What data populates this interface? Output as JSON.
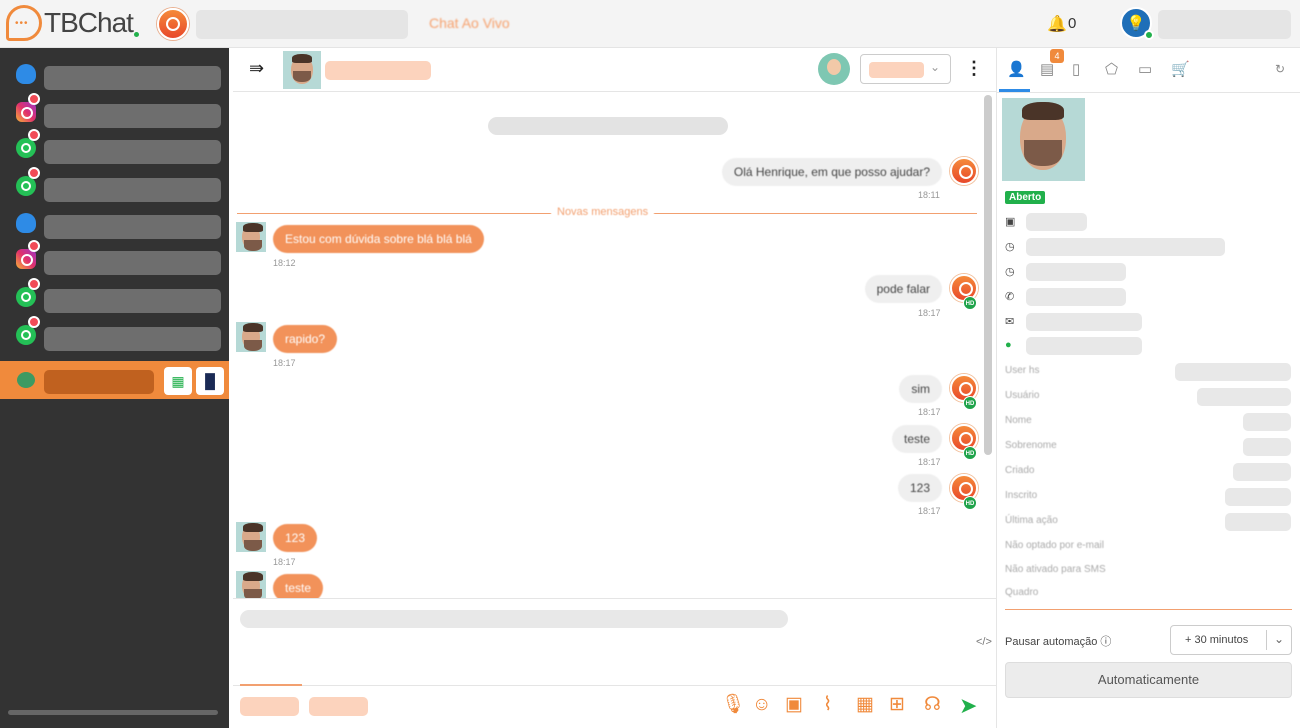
{
  "topbar": {
    "logo_text": "TBChat",
    "live_label": "Chat Ao Vivo",
    "notif_count": "0"
  },
  "sidebar": {
    "items": [
      {
        "channel": "user-icon",
        "badge": false
      },
      {
        "channel": "instagram-icon",
        "badge": true
      },
      {
        "channel": "whatsapp-icon",
        "badge": true
      },
      {
        "channel": "whatsapp-icon",
        "badge": true
      },
      {
        "channel": "user-icon",
        "badge": false
      },
      {
        "channel": "instagram-icon",
        "badge": true
      },
      {
        "channel": "whatsapp-icon",
        "badge": true
      },
      {
        "channel": "whatsapp-icon",
        "badge": true
      }
    ]
  },
  "chat": {
    "new_messages_label": "Novas mensagens",
    "messages": [
      {
        "dir": "out",
        "text": "Olá Henrique, em que posso ajudar?",
        "time": "18:11",
        "hd": false
      },
      {
        "dir": "in",
        "text": "Estou com dúvida sobre blá blá blá",
        "time": "18:12"
      },
      {
        "dir": "out",
        "text": "pode falar",
        "time": "18:17",
        "hd": true
      },
      {
        "dir": "in",
        "text": "rapido?",
        "time": "18:17"
      },
      {
        "dir": "out",
        "text": "sim",
        "time": "18:17",
        "hd": true
      },
      {
        "dir": "out",
        "text": "teste",
        "time": "18:17",
        "hd": true
      },
      {
        "dir": "out",
        "text": "123",
        "time": "18:17",
        "hd": true
      },
      {
        "dir": "in",
        "text": "123",
        "time": "18:17"
      },
      {
        "dir": "in",
        "text": "teste",
        "time": ""
      }
    ],
    "hd_badge": "HD",
    "code_toggle": "</>"
  },
  "panel": {
    "tab_badge": "4",
    "status": "Aberto",
    "attributes": [
      "User hs",
      "Usuário",
      "Nome",
      "Sobrenome",
      "Criado",
      "Inscrito",
      "Última ação",
      "Não optado por e-mail",
      "Não ativado para SMS",
      "Quadro"
    ],
    "pause_label": "Pausar automação ⓘ",
    "pause_value": "+ 30 minutos",
    "auto_button": "Automaticamente"
  },
  "colors": {
    "accent": "#f08a3c",
    "sidebar_bg": "#333333",
    "status_green": "#21b04b",
    "tab_blue": "#2e8be6"
  }
}
